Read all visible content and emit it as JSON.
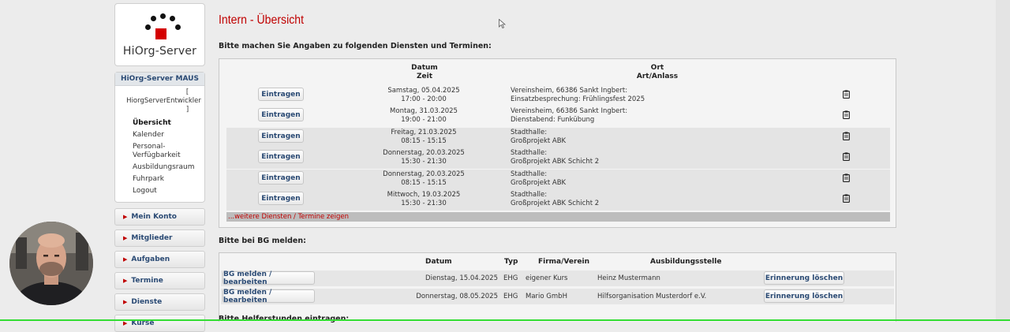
{
  "logo": {
    "text": "HiOrg-Server"
  },
  "user": {
    "org": "HiOrg-Server MAUS",
    "bracket_open": "[",
    "name": "HiorgServerEntwickler",
    "bracket_close": "]"
  },
  "nav": [
    "Übersicht",
    "Kalender",
    "Personal-Verfügbarkeit",
    "Ausbildungsraum",
    "Fuhrpark",
    "Logout"
  ],
  "menu": [
    "Mein Konto",
    "Mitglieder",
    "Aufgaben",
    "Termine",
    "Dienste",
    "Kurse"
  ],
  "page": {
    "title": "Intern - Übersicht",
    "intro": "Bitte machen Sie Angaben zu folgenden Diensten und Terminen:"
  },
  "dienste": {
    "header_date_line1": "Datum",
    "header_date_line2": "Zeit",
    "header_place_line1": "Ort",
    "header_place_line2": "Art/Anlass",
    "button_label": "Eintragen",
    "rows": [
      {
        "date": "Samstag, 05.04.2025",
        "time": "17:00 - 20:00",
        "place": "Vereinsheim, 66386 Sankt Ingbert:",
        "event": "Einsatzbesprechung: Frühlingsfest 2025"
      },
      {
        "date": "Montag, 31.03.2025",
        "time": "19:00 - 21:00",
        "place": "Vereinsheim, 66386 Sankt Ingbert:",
        "event": "Dienstabend: Funkübung"
      },
      {
        "date": "Freitag, 21.03.2025",
        "time": "08:15 - 15:15",
        "place": "Stadthalle:",
        "event": "Großprojekt ABK"
      },
      {
        "date": "Donnerstag, 20.03.2025",
        "time": "15:30 - 21:30",
        "place": "Stadthalle:",
        "event": "Großprojekt ABK Schicht 2"
      },
      {
        "date": "Donnerstag, 20.03.2025",
        "time": "08:15 - 15:15",
        "place": "Stadthalle:",
        "event": "Großprojekt ABK"
      },
      {
        "date": "Mittwoch, 19.03.2025",
        "time": "15:30 - 21:30",
        "place": "Stadthalle:",
        "event": "Großprojekt ABK Schicht 2"
      }
    ],
    "more_link": "...weitere Diensten / Termine zeigen"
  },
  "bg": {
    "title": "Bitte bei BG melden:",
    "headers": {
      "datum": "Datum",
      "typ": "Typ",
      "firma": "Firma/Verein",
      "stelle": "Ausbildungsstelle"
    },
    "button_label": "BG melden / bearbeiten",
    "delete_label": "Erinnerung löschen",
    "rows": [
      {
        "date": "Dienstag, 15.04.2025",
        "typ": "EHG",
        "firma": "eigener Kurs",
        "stelle": "Heinz Mustermann"
      },
      {
        "date": "Donnerstag, 08.05.2025",
        "typ": "EHG",
        "firma": "Mario GmbH",
        "stelle": "Hilfsorganisation Musterdorf e.V."
      }
    ]
  },
  "helfer": {
    "title": "Bitte Helferstunden eintragen:"
  },
  "colors": {
    "accent": "#c00000",
    "link": "#2a4a74"
  }
}
